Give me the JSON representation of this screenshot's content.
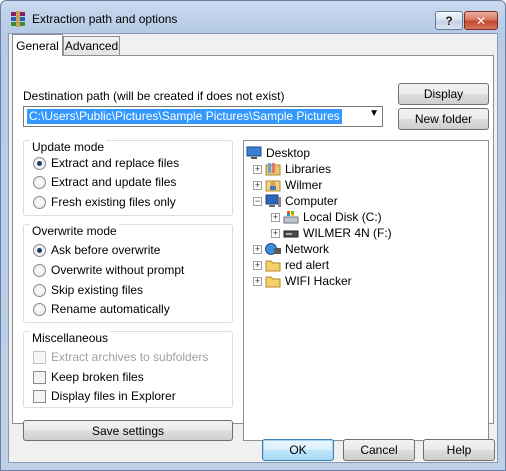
{
  "window": {
    "title": "Extraction path and options",
    "help_glyph": "?",
    "close_glyph": "✕"
  },
  "tabs": [
    {
      "label": "General",
      "active": true
    },
    {
      "label": "Advanced",
      "active": false
    }
  ],
  "destination": {
    "label": "Destination path (will be created if does not exist)",
    "value": "C:\\Users\\Public\\Pictures\\Sample Pictures\\Sample Pictures"
  },
  "buttons": {
    "display": "Display",
    "new_folder": "New folder",
    "save_settings": "Save settings",
    "ok": "OK",
    "cancel": "Cancel",
    "help": "Help"
  },
  "update_mode": {
    "title": "Update mode",
    "options": [
      {
        "label": "Extract and replace files",
        "selected": true
      },
      {
        "label": "Extract and update files",
        "selected": false
      },
      {
        "label": "Fresh existing files only",
        "selected": false
      }
    ]
  },
  "overwrite_mode": {
    "title": "Overwrite mode",
    "options": [
      {
        "label": "Ask before overwrite",
        "selected": true
      },
      {
        "label": "Overwrite without prompt",
        "selected": false
      },
      {
        "label": "Skip existing files",
        "selected": false
      },
      {
        "label": "Rename automatically",
        "selected": false
      }
    ]
  },
  "miscellaneous": {
    "title": "Miscellaneous",
    "options": [
      {
        "label": "Extract archives to subfolders",
        "checked": false,
        "enabled": false
      },
      {
        "label": "Keep broken files",
        "checked": false,
        "enabled": true
      },
      {
        "label": "Display files in Explorer",
        "checked": false,
        "enabled": true
      }
    ]
  },
  "tree": {
    "nodes": [
      {
        "label": "Desktop",
        "icon": "desktop-icon",
        "expander": ""
      },
      {
        "label": "Libraries",
        "icon": "libraries-icon",
        "expander": "+"
      },
      {
        "label": "Wilmer",
        "icon": "user-folder-icon",
        "expander": "+"
      },
      {
        "label": "Computer",
        "icon": "computer-icon",
        "expander": "−"
      },
      {
        "label": "Local Disk (C:)",
        "icon": "hard-drive-icon",
        "expander": "+"
      },
      {
        "label": "WILMER 4N (F:)",
        "icon": "removable-drive-icon",
        "expander": "+"
      },
      {
        "label": "Network",
        "icon": "network-icon",
        "expander": "+"
      },
      {
        "label": "red alert",
        "icon": "folder-icon",
        "expander": "+"
      },
      {
        "label": "WIFI Hacker",
        "icon": "folder-icon",
        "expander": "+"
      }
    ]
  }
}
